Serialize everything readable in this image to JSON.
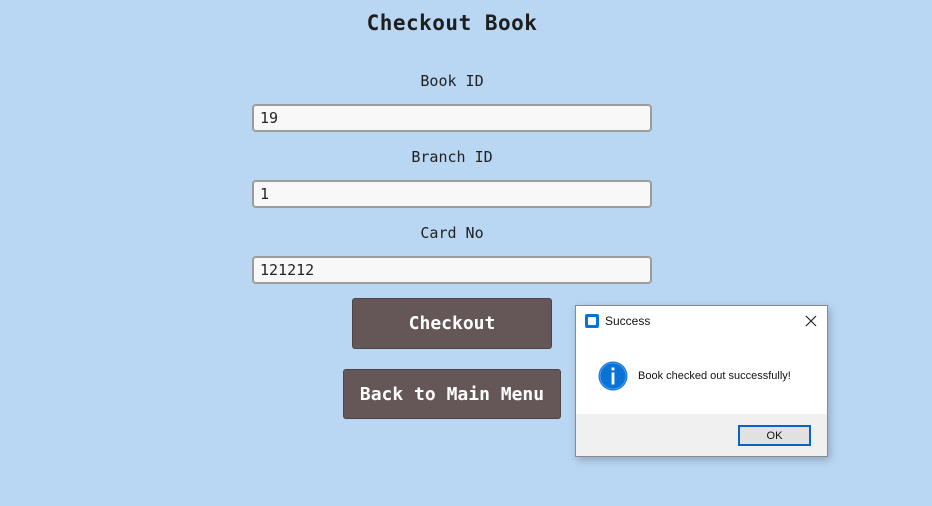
{
  "page": {
    "title": "Checkout Book"
  },
  "form": {
    "book_id": {
      "label": "Book ID",
      "value": "19"
    },
    "branch_id": {
      "label": "Branch ID",
      "value": "1"
    },
    "card_no": {
      "label": "Card No",
      "value": "121212"
    }
  },
  "buttons": {
    "checkout_label": "Checkout",
    "back_label": "Back to Main Menu"
  },
  "dialog": {
    "title": "Success",
    "message": "Book checked out successfully!",
    "ok_label": "OK",
    "icon": "info-icon",
    "close_icon": "close-icon",
    "app_icon": "app-icon"
  },
  "colors": {
    "background": "#b9d6f3",
    "button": "#655757",
    "info_accent": "#0a74d6"
  }
}
